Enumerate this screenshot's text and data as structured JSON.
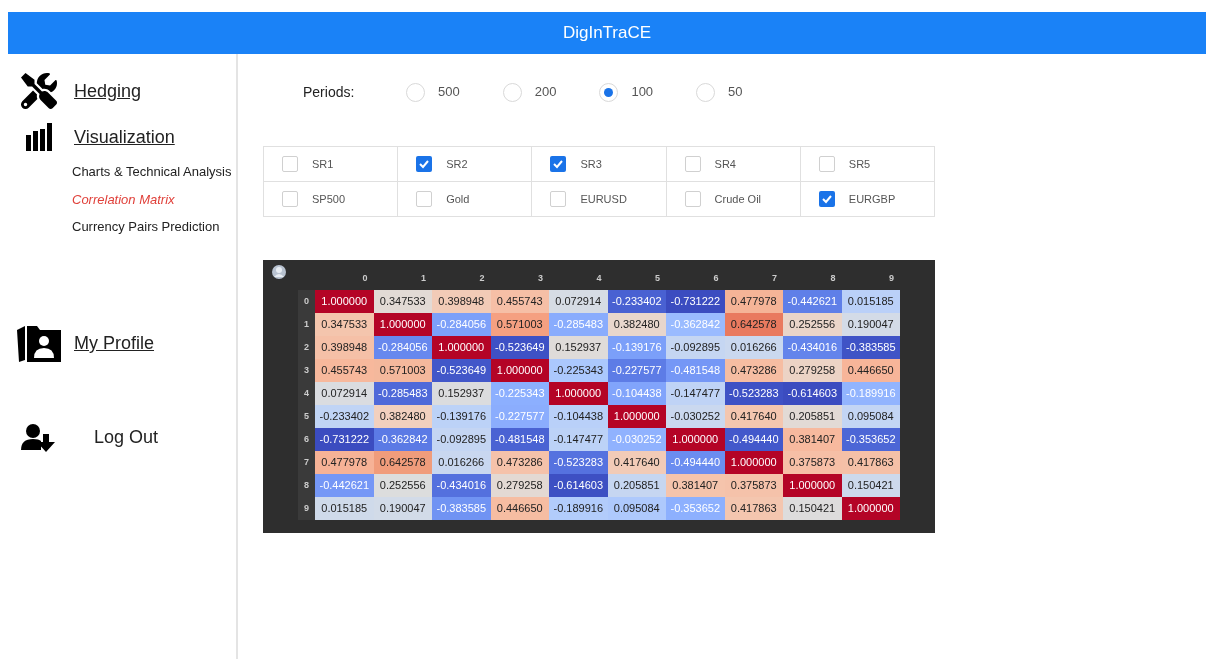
{
  "header": {
    "title": "DigInTraCE"
  },
  "sidebar": {
    "items": [
      {
        "label": "Hedging",
        "kind": "link"
      },
      {
        "label": "Visualization",
        "kind": "link",
        "children": [
          {
            "label": "Charts & Technical Analysis",
            "selected": false
          },
          {
            "label": "Correlation Matrix",
            "selected": true
          },
          {
            "label": "Currency Pairs Prediction",
            "selected": false
          }
        ]
      },
      {
        "label": "My Profile",
        "kind": "link"
      },
      {
        "label": "Log Out",
        "kind": "action"
      }
    ]
  },
  "periods": {
    "label": "Periods:",
    "options": [
      {
        "label": "500",
        "selected": false
      },
      {
        "label": "200",
        "selected": false
      },
      {
        "label": "100",
        "selected": true
      },
      {
        "label": "50",
        "selected": false
      }
    ]
  },
  "series": [
    {
      "label": "SR1",
      "checked": false
    },
    {
      "label": "SR2",
      "checked": true
    },
    {
      "label": "SR3",
      "checked": true
    },
    {
      "label": "SR4",
      "checked": false
    },
    {
      "label": "SR5",
      "checked": false
    },
    {
      "label": "SP500",
      "checked": false
    },
    {
      "label": "Gold",
      "checked": false
    },
    {
      "label": "EURUSD",
      "checked": false
    },
    {
      "label": "Crude Oil",
      "checked": false
    },
    {
      "label": "EURGBP",
      "checked": true
    }
  ],
  "matrix": {
    "columns": [
      "0",
      "1",
      "2",
      "3",
      "4",
      "5",
      "6",
      "7",
      "8",
      "9"
    ],
    "rows": [
      {
        "label": "0",
        "cells": [
          {
            "text": "1.000000",
            "color": "#b40426"
          },
          {
            "text": "0.347533",
            "color": "#e2dad5"
          },
          {
            "text": "0.398948",
            "color": "#f2cbb7"
          },
          {
            "text": "0.455743",
            "color": "#f6bfa6"
          },
          {
            "text": "0.072914",
            "color": "#d6dce4"
          },
          {
            "text": "-0.233402",
            "color": "#4961d2"
          },
          {
            "text": "-0.731222",
            "color": "#3b4cc0"
          },
          {
            "text": "0.477978",
            "color": "#f5b497"
          },
          {
            "text": "-0.442621",
            "color": "#5f7fe8"
          },
          {
            "text": "0.015185",
            "color": "#bad0f8"
          }
        ]
      },
      {
        "label": "1",
        "cells": [
          {
            "text": "0.347533",
            "color": "#f4c5ad"
          },
          {
            "text": "1.000000",
            "color": "#b40426"
          },
          {
            "text": "-0.284056",
            "color": "#7da0f9"
          },
          {
            "text": "0.571003",
            "color": "#f5a081"
          },
          {
            "text": "-0.285483",
            "color": "#89acfd"
          },
          {
            "text": "0.382480",
            "color": "#e8d6cc"
          },
          {
            "text": "-0.362842",
            "color": "#9abbff"
          },
          {
            "text": "0.642578",
            "color": "#e97a5f"
          },
          {
            "text": "0.252556",
            "color": "#ead5c9"
          },
          {
            "text": "0.190047",
            "color": "#d3dbe7"
          }
        ]
      },
      {
        "label": "2",
        "cells": [
          {
            "text": "0.398948",
            "color": "#f5c0a7"
          },
          {
            "text": "-0.284056",
            "color": "#6788ee"
          },
          {
            "text": "1.000000",
            "color": "#b40426"
          },
          {
            "text": "-0.523649",
            "color": "#3e51c5"
          },
          {
            "text": "0.152937",
            "color": "#dfdbd9"
          },
          {
            "text": "-0.139176",
            "color": "#7b9ff9"
          },
          {
            "text": "-0.092895",
            "color": "#c5d6f2"
          },
          {
            "text": "0.016266",
            "color": "#cad8ef"
          },
          {
            "text": "-0.434016",
            "color": "#6384eb"
          },
          {
            "text": "-0.383585",
            "color": "#3f53c6"
          }
        ]
      },
      {
        "label": "3",
        "cells": [
          {
            "text": "0.455743",
            "color": "#f7b89c"
          },
          {
            "text": "0.571003",
            "color": "#f4b89c"
          },
          {
            "text": "-0.523649",
            "color": "#4257c9"
          },
          {
            "text": "1.000000",
            "color": "#b40426"
          },
          {
            "text": "-0.225343",
            "color": "#abc8fd"
          },
          {
            "text": "-0.227577",
            "color": "#5d7ce6"
          },
          {
            "text": "-0.481548",
            "color": "#7597f6"
          },
          {
            "text": "0.473286",
            "color": "#f6bda2"
          },
          {
            "text": "0.279258",
            "color": "#ecd3c5"
          },
          {
            "text": "0.446650",
            "color": "#f7b599"
          }
        ]
      },
      {
        "label": "4",
        "cells": [
          {
            "text": "0.072914",
            "color": "#dadce0"
          },
          {
            "text": "-0.285483",
            "color": "#4f69d9"
          },
          {
            "text": "0.152937",
            "color": "#dbdcde"
          },
          {
            "text": "-0.225343",
            "color": "#8caffe"
          },
          {
            "text": "1.000000",
            "color": "#b40426"
          },
          {
            "text": "-0.104438",
            "color": "#81a4fb"
          },
          {
            "text": "-0.147477",
            "color": "#bfd3f6"
          },
          {
            "text": "-0.523283",
            "color": "#3e51c5"
          },
          {
            "text": "-0.614603",
            "color": "#3b4cc0"
          },
          {
            "text": "-0.189916",
            "color": "#92b4fe"
          }
        ]
      },
      {
        "label": "5",
        "cells": [
          {
            "text": "-0.233402",
            "color": "#c0d4f5"
          },
          {
            "text": "0.382480",
            "color": "#f2d0be"
          },
          {
            "text": "-0.139176",
            "color": "#bcd2f7"
          },
          {
            "text": "-0.227577",
            "color": "#8badfd"
          },
          {
            "text": "-0.104438",
            "color": "#b9d0f9"
          },
          {
            "text": "1.000000",
            "color": "#b40426"
          },
          {
            "text": "-0.030252",
            "color": "#cad8ef"
          },
          {
            "text": "0.417640",
            "color": "#f4c6af"
          },
          {
            "text": "0.205851",
            "color": "#e2dad5"
          },
          {
            "text": "0.095084",
            "color": "#c3d5f4"
          }
        ]
      },
      {
        "label": "6",
        "cells": [
          {
            "text": "-0.731222",
            "color": "#3b4cc0"
          },
          {
            "text": "-0.362842",
            "color": "#5b7ae5"
          },
          {
            "text": "-0.092895",
            "color": "#c4d5f3"
          },
          {
            "text": "-0.481548",
            "color": "#4a63d3"
          },
          {
            "text": "-0.147477",
            "color": "#bcd2f7"
          },
          {
            "text": "-0.030252",
            "color": "#90b2fe"
          },
          {
            "text": "1.000000",
            "color": "#b40426"
          },
          {
            "text": "-0.494440",
            "color": "#4358cb"
          },
          {
            "text": "0.381407",
            "color": "#f7b99e"
          },
          {
            "text": "-0.353652",
            "color": "#4c66d6"
          }
        ]
      },
      {
        "label": "7",
        "cells": [
          {
            "text": "0.477978",
            "color": "#f6b296"
          },
          {
            "text": "0.642578",
            "color": "#f09c7b"
          },
          {
            "text": "0.016266",
            "color": "#c9d7f0"
          },
          {
            "text": "0.473286",
            "color": "#f5c2aa"
          },
          {
            "text": "-0.523283",
            "color": "#5572df"
          },
          {
            "text": "0.417640",
            "color": "#f2cbb7"
          },
          {
            "text": "-0.494440",
            "color": "#6b8df0"
          },
          {
            "text": "1.000000",
            "color": "#b40426"
          },
          {
            "text": "0.375873",
            "color": "#f6bfa6"
          },
          {
            "text": "0.417863",
            "color": "#f5c0a7"
          }
        ]
      },
      {
        "label": "8",
        "cells": [
          {
            "text": "-0.442621",
            "color": "#7597f6"
          },
          {
            "text": "0.252556",
            "color": "#dcdddd"
          },
          {
            "text": "-0.434016",
            "color": "#5470de"
          },
          {
            "text": "0.279258",
            "color": "#e3d9d3"
          },
          {
            "text": "-0.614603",
            "color": "#3d50c3"
          },
          {
            "text": "0.205851",
            "color": "#c6d6f1"
          },
          {
            "text": "0.381407",
            "color": "#f5c4ac"
          },
          {
            "text": "0.375873",
            "color": "#f5c2aa"
          },
          {
            "text": "1.000000",
            "color": "#b40426"
          },
          {
            "text": "0.150421",
            "color": "#cdd9ec"
          }
        ]
      },
      {
        "label": "9",
        "cells": [
          {
            "text": "0.015185",
            "color": "#cfdaea"
          },
          {
            "text": "0.190047",
            "color": "#d2dbe8"
          },
          {
            "text": "-0.383585",
            "color": "#7093f3"
          },
          {
            "text": "0.446650",
            "color": "#f6bda2"
          },
          {
            "text": "-0.189916",
            "color": "#b2ccfb"
          },
          {
            "text": "0.095084",
            "color": "#aec9fc"
          },
          {
            "text": "-0.353652",
            "color": "#8db0fe"
          },
          {
            "text": "0.417863",
            "color": "#f4c6af"
          },
          {
            "text": "0.150421",
            "color": "#dddcdc"
          },
          {
            "text": "1.000000",
            "color": "#b40426"
          }
        ]
      }
    ]
  }
}
